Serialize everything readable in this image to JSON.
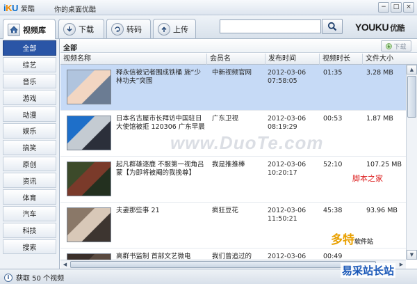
{
  "window": {
    "logo_brand": "爱酷",
    "title": "你的桌面优酷",
    "min_label": "−",
    "max_label": "□",
    "close_label": "×"
  },
  "toolbar": {
    "tabs": [
      {
        "label": "视频库"
      },
      {
        "label": "下载"
      },
      {
        "label": "转码"
      },
      {
        "label": "上传"
      }
    ],
    "search": {
      "value": "",
      "placeholder": ""
    },
    "brand_en": "YOUKU",
    "brand_cn": "优酷"
  },
  "sidebar": {
    "items": [
      {
        "label": "全部"
      },
      {
        "label": "综艺"
      },
      {
        "label": "音乐"
      },
      {
        "label": "游戏"
      },
      {
        "label": "动漫"
      },
      {
        "label": "娱乐"
      },
      {
        "label": "搞笑"
      },
      {
        "label": "原创"
      },
      {
        "label": "资讯"
      },
      {
        "label": "体育"
      },
      {
        "label": "汽车"
      },
      {
        "label": "科技"
      },
      {
        "label": "搜索"
      }
    ]
  },
  "main": {
    "title": "全部",
    "download_label": "下载",
    "columns": {
      "name": "视频名称",
      "member": "会员名",
      "date": "发布时间",
      "duration": "视频时长",
      "size": "文件大小"
    },
    "rows": [
      {
        "title": "释永信被记者围成铁桶 施“少林功夫”突围",
        "member": "中新视频官网",
        "date": "2012-03-06 07:58:05",
        "duration": "01:35",
        "size": "3.28 MB",
        "thumb_colors": [
          "#b0c4de",
          "#f2d6c2",
          "#6b7c93"
        ]
      },
      {
        "title": "日本名古屋市长拜访中国驻日大使馆被拒 120306 广东早晨",
        "member": "广东卫视",
        "date": "2012-03-06 08:19:29",
        "duration": "00:53",
        "size": "1.87 MB",
        "thumb_colors": [
          "#1e6fc9",
          "#c4cbd2",
          "#2b2f3a"
        ]
      },
      {
        "title": "起凡群雄逐鹿 不服第一视角吕蒙【为即将被阉的我挽尊】",
        "member": "我是推推棒",
        "date": "2012-03-06 10:20:17",
        "duration": "52:10",
        "size": "107.25 MB",
        "thumb_colors": [
          "#3c4a2a",
          "#7a3a2a",
          "#23301f"
        ]
      },
      {
        "title": "夫妻那些事 21",
        "member": "疯狂豆花",
        "date": "2012-03-06 11:50:21",
        "duration": "45:38",
        "size": "93.96 MB",
        "thumb_colors": [
          "#8a7868",
          "#d8c8b8",
          "#3d3530"
        ]
      },
      {
        "title": "高群书监制 首部文艺微电",
        "member": "我们曾追过的",
        "date": "2012-03-06",
        "duration": "00:49",
        "size": "",
        "thumb_colors": [
          "#3a2f2a",
          "#5a4a40",
          "#222"
        ]
      }
    ]
  },
  "status": {
    "text": "获取 50 个视频"
  },
  "watermarks": {
    "center": "www.DuoTe.com",
    "corner_top": "多特",
    "corner_top_small": "软件站",
    "corner_red": "脚本之家",
    "corner_bottom": "易采站长站"
  }
}
